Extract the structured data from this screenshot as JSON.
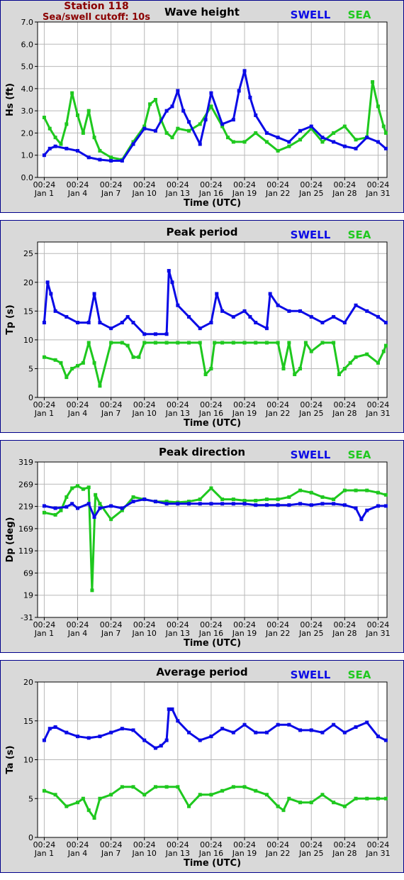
{
  "station": {
    "title": "Station 118",
    "cutoff": "Sea/swell cutoff: 10s"
  },
  "legend": {
    "swell_label": "SWELL",
    "sea_label": "SEA"
  },
  "colors": {
    "swell": "#0a0ae6",
    "sea": "#1ec81e",
    "title_red": "#8b0000",
    "frame": "#00008b",
    "panel_bg": "#d9d9d9"
  },
  "x_axis": {
    "label": "Time (UTC)",
    "tick_times": [
      "00:24",
      "00:24",
      "00:24",
      "00:24",
      "00:24",
      "00:24",
      "00:24",
      "00:24",
      "00:24",
      "00:24",
      "00:24"
    ],
    "tick_dates": [
      "Jan 1",
      "Jan 4",
      "Jan 7",
      "Jan 10",
      "Jan 13",
      "Jan 16",
      "Jan 19",
      "Jan 22",
      "Jan 25",
      "Jan 28",
      "Jan 31"
    ]
  },
  "chart_data": [
    {
      "type": "line",
      "title": "Wave height",
      "ylabel": "Hs (ft)",
      "ylim": [
        0,
        7
      ],
      "yticks": [
        "0.0",
        "1.0",
        "2.0",
        "3.0",
        "4.0",
        "5.0",
        "6.0",
        "7.0"
      ],
      "x_days": [
        1,
        31.7
      ],
      "series": [
        {
          "name": "SWELL",
          "x": [
            1,
            1.5,
            2,
            3,
            4,
            5,
            6,
            7,
            8,
            9,
            10,
            11,
            12,
            12.5,
            13,
            13.5,
            14,
            15,
            15.5,
            16,
            17,
            18,
            18.5,
            19,
            19.5,
            20,
            21,
            22,
            23,
            24,
            25,
            26,
            27,
            28,
            29,
            30,
            31,
            31.7
          ],
          "y": [
            1.0,
            1.3,
            1.4,
            1.3,
            1.2,
            0.9,
            0.8,
            0.75,
            0.75,
            1.5,
            2.2,
            2.1,
            3.0,
            3.2,
            3.9,
            3.0,
            2.5,
            1.5,
            2.6,
            3.8,
            2.4,
            2.6,
            3.9,
            4.8,
            3.6,
            2.8,
            2.0,
            1.8,
            1.6,
            2.1,
            2.3,
            1.8,
            1.6,
            1.4,
            1.3,
            1.8,
            1.6,
            1.3
          ]
        },
        {
          "name": "SEA",
          "x": [
            1,
            1.5,
            2,
            2.5,
            3,
            3.5,
            4,
            4.5,
            5,
            5.5,
            6,
            7,
            8,
            9,
            10,
            10.5,
            11,
            11.5,
            12,
            12.5,
            13,
            14,
            15,
            16,
            17,
            17.5,
            18,
            19,
            20,
            21,
            22,
            23,
            24,
            25,
            26,
            27,
            28,
            29,
            30,
            30.5,
            31,
            31.5,
            31.7
          ],
          "y": [
            2.7,
            2.2,
            1.8,
            1.5,
            2.4,
            3.8,
            2.8,
            2.0,
            3.0,
            1.8,
            1.2,
            0.9,
            0.8,
            1.6,
            2.3,
            3.3,
            3.5,
            2.6,
            2.0,
            1.8,
            2.2,
            2.1,
            2.4,
            3.2,
            2.3,
            1.8,
            1.6,
            1.6,
            2.0,
            1.6,
            1.2,
            1.4,
            1.7,
            2.2,
            1.6,
            2.0,
            2.3,
            1.7,
            1.8,
            4.3,
            3.2,
            2.3,
            2.0
          ]
        }
      ]
    },
    {
      "type": "line",
      "title": "Peak period",
      "ylabel": "Tp (s)",
      "ylim": [
        0,
        27
      ],
      "yticks": [
        "0",
        "5",
        "10",
        "15",
        "20",
        "25"
      ],
      "series": [
        {
          "name": "SWELL",
          "x": [
            1,
            1.3,
            1.6,
            2,
            3,
            4,
            5,
            5.5,
            6,
            7,
            8,
            8.5,
            9,
            10,
            11,
            12,
            12.2,
            12.5,
            13,
            14,
            15,
            16,
            16.5,
            17,
            18,
            19,
            19.5,
            20,
            21,
            21.3,
            22,
            23,
            24,
            25,
            26,
            27,
            28,
            29,
            30,
            31,
            31.7
          ],
          "y": [
            13,
            20,
            18,
            15,
            14,
            13,
            13,
            18,
            13,
            12,
            13,
            14,
            13,
            11,
            11,
            11,
            22,
            20,
            16,
            14,
            12,
            13,
            18,
            15,
            14,
            15,
            14,
            13,
            12,
            18,
            16,
            15,
            15,
            14,
            13,
            14,
            13,
            16,
            15,
            14,
            13
          ]
        },
        {
          "name": "SEA",
          "x": [
            1,
            2,
            2.5,
            3,
            3.5,
            4,
            4.5,
            5,
            5.5,
            6,
            7,
            8,
            8.5,
            9,
            9.5,
            10,
            11,
            12,
            13,
            14,
            15,
            15.5,
            16,
            16.3,
            17,
            18,
            19,
            20,
            21,
            22,
            22.5,
            23,
            23.5,
            24,
            24.5,
            25,
            26,
            27,
            27.5,
            28,
            28.5,
            29,
            30,
            31,
            31.5,
            31.7
          ],
          "y": [
            7,
            6.5,
            6,
            3.5,
            5,
            5.5,
            6,
            9.5,
            6,
            2,
            9.5,
            9.5,
            9,
            7,
            7,
            9.5,
            9.5,
            9.5,
            9.5,
            9.5,
            9.5,
            4,
            5,
            9.5,
            9.5,
            9.5,
            9.5,
            9.5,
            9.5,
            9.5,
            5,
            9.5,
            4,
            5,
            9.5,
            8,
            9.5,
            9.5,
            4,
            5,
            6,
            7,
            7.5,
            6,
            8,
            9
          ]
        }
      ]
    },
    {
      "type": "line",
      "title": "Peak direction",
      "ylabel": "Dp (deg)",
      "ylim": [
        -31,
        319
      ],
      "yticks": [
        "-31",
        "19",
        "69",
        "119",
        "169",
        "219",
        "269",
        "319"
      ],
      "series": [
        {
          "name": "SWELL",
          "x": [
            1,
            2,
            3,
            3.5,
            4,
            5,
            5.5,
            6,
            7,
            8,
            9,
            10,
            11,
            12,
            13,
            14,
            15,
            16,
            17,
            18,
            19,
            20,
            21,
            22,
            23,
            24,
            25,
            26,
            27,
            28,
            29,
            29.5,
            30,
            31,
            31.7
          ],
          "y": [
            220,
            215,
            218,
            225,
            215,
            225,
            195,
            215,
            220,
            215,
            230,
            235,
            230,
            225,
            225,
            225,
            225,
            225,
            225,
            225,
            225,
            222,
            222,
            222,
            222,
            225,
            222,
            225,
            225,
            222,
            215,
            190,
            210,
            220,
            220
          ]
        },
        {
          "name": "SEA",
          "x": [
            1,
            2,
            2.5,
            3,
            3.5,
            4,
            4.5,
            5,
            5.3,
            5.6,
            6,
            7,
            8,
            9,
            10,
            11,
            12,
            13,
            14,
            15,
            16,
            17,
            18,
            19,
            20,
            21,
            22,
            23,
            24,
            25,
            26,
            27,
            28,
            29,
            30,
            31,
            31.7
          ],
          "y": [
            205,
            200,
            210,
            240,
            260,
            265,
            258,
            262,
            30,
            245,
            225,
            190,
            210,
            240,
            235,
            230,
            230,
            228,
            230,
            235,
            260,
            235,
            235,
            232,
            232,
            235,
            235,
            240,
            255,
            250,
            240,
            235,
            255,
            255,
            255,
            250,
            245
          ]
        }
      ]
    },
    {
      "type": "line",
      "title": "Average period",
      "ylabel": "Ta (s)",
      "ylim": [
        0,
        20
      ],
      "yticks": [
        "0",
        "5",
        "10",
        "15",
        "20"
      ],
      "series": [
        {
          "name": "SWELL",
          "x": [
            1,
            1.5,
            2,
            3,
            4,
            5,
            6,
            7,
            8,
            9,
            10,
            11,
            11.5,
            12,
            12.2,
            12.5,
            13,
            14,
            15,
            16,
            17,
            18,
            19,
            20,
            21,
            22,
            23,
            24,
            25,
            26,
            27,
            28,
            29,
            30,
            31,
            31.7
          ],
          "y": [
            12.5,
            14,
            14.2,
            13.5,
            13,
            12.8,
            13,
            13.5,
            14,
            13.8,
            12.5,
            11.5,
            11.8,
            12.5,
            16.5,
            16.5,
            15,
            13.5,
            12.5,
            13,
            14,
            13.5,
            14.5,
            13.5,
            13.5,
            14.5,
            14.5,
            13.8,
            13.8,
            13.5,
            14.5,
            13.5,
            14.2,
            14.8,
            13,
            12.5
          ]
        },
        {
          "name": "SEA",
          "x": [
            1,
            2,
            3,
            4,
            4.5,
            5,
            5.5,
            6,
            7,
            8,
            9,
            10,
            11,
            12,
            13,
            14,
            15,
            16,
            17,
            18,
            19,
            20,
            21,
            22,
            22.5,
            23,
            24,
            25,
            26,
            27,
            28,
            29,
            30,
            31,
            31.7
          ],
          "y": [
            6,
            5.5,
            4,
            4.5,
            5,
            3.5,
            2.5,
            5,
            5.5,
            6.5,
            6.5,
            5.5,
            6.5,
            6.5,
            6.5,
            4,
            5.5,
            5.5,
            6,
            6.5,
            6.5,
            6,
            5.5,
            4,
            3.5,
            5,
            4.5,
            4.5,
            5.5,
            4.5,
            4,
            5,
            5,
            5,
            5
          ]
        }
      ]
    }
  ]
}
